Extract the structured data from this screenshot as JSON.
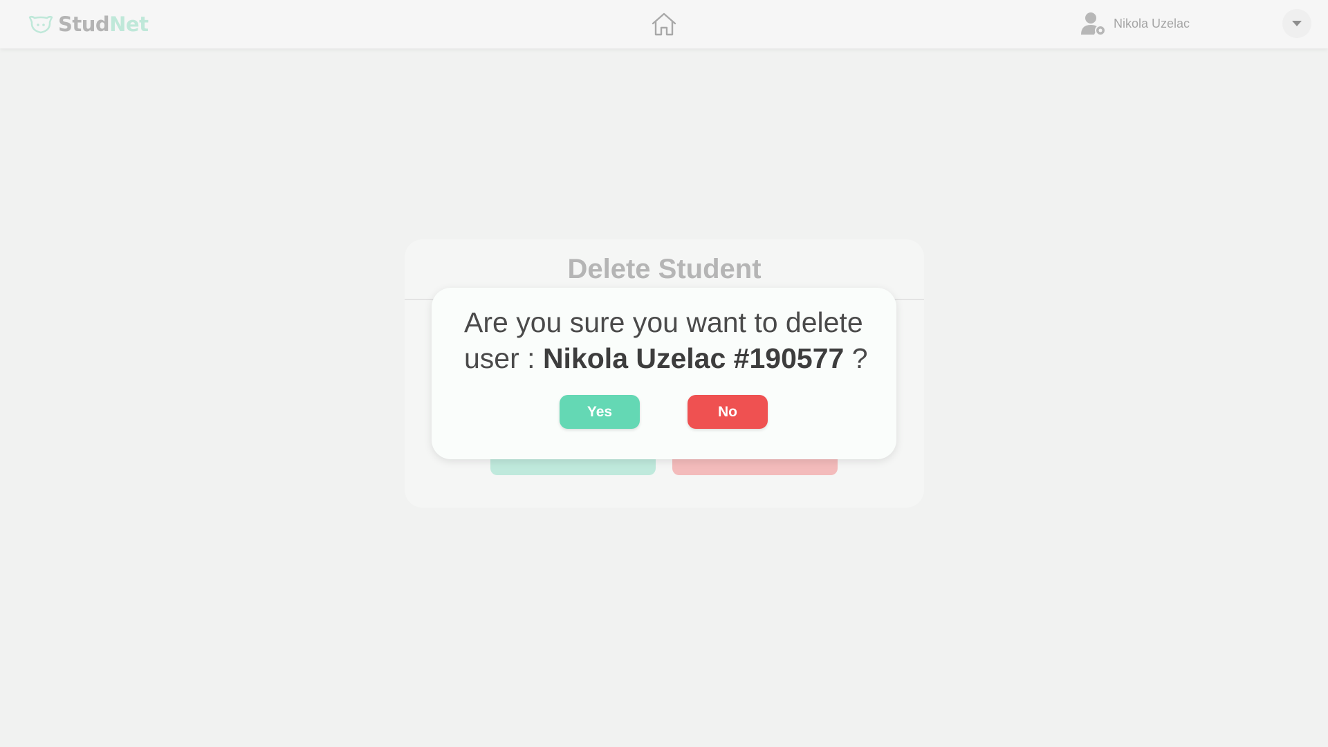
{
  "header": {
    "logo": {
      "part1": "Stud",
      "part2": "Net"
    },
    "home_icon": "home-icon",
    "user": {
      "name": "Nikola Uzelac",
      "icon": "user-settings-icon"
    },
    "dropdown_icon": "caret-down-icon"
  },
  "card": {
    "title": "Delete Student"
  },
  "modal": {
    "prefix": "Are you sure you want to delete user :",
    "user_label": "Nikola Uzelac #190577",
    "suffix": "?",
    "yes_label": "Yes",
    "no_label": "No"
  },
  "colors": {
    "accent_green": "#64d8b4",
    "danger_red": "#ef5151",
    "background": "#f1f2f1"
  }
}
